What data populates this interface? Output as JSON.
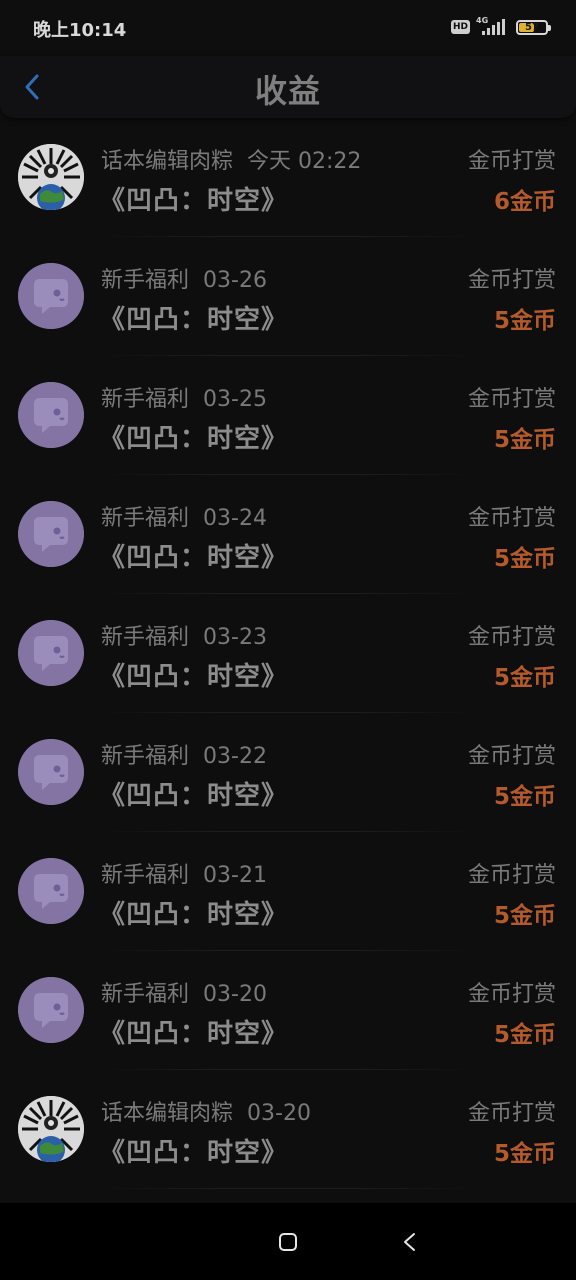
{
  "status_bar": {
    "time": "晚上10:14",
    "hd": "HD",
    "network": "4G",
    "battery": "57",
    "battery_level": 0.57,
    "battery_color": "#e3b32d"
  },
  "header": {
    "title": "收益",
    "back_icon": "chevron-left-icon",
    "accent": "#2f6fb8"
  },
  "items": [
    {
      "sender": "话本编辑肉粽",
      "date": "今天 02:22",
      "title": "《凹凸：时空》",
      "type": "金币打赏",
      "amount": "6金币",
      "avatar": "globe"
    },
    {
      "sender": "新手福利",
      "date": "03-26",
      "title": "《凹凸：时空》",
      "type": "金币打赏",
      "amount": "5金币",
      "avatar": "chat"
    },
    {
      "sender": "新手福利",
      "date": "03-25",
      "title": "《凹凸：时空》",
      "type": "金币打赏",
      "amount": "5金币",
      "avatar": "chat"
    },
    {
      "sender": "新手福利",
      "date": "03-24",
      "title": "《凹凸：时空》",
      "type": "金币打赏",
      "amount": "5金币",
      "avatar": "chat"
    },
    {
      "sender": "新手福利",
      "date": "03-23",
      "title": "《凹凸：时空》",
      "type": "金币打赏",
      "amount": "5金币",
      "avatar": "chat"
    },
    {
      "sender": "新手福利",
      "date": "03-22",
      "title": "《凹凸：时空》",
      "type": "金币打赏",
      "amount": "5金币",
      "avatar": "chat"
    },
    {
      "sender": "新手福利",
      "date": "03-21",
      "title": "《凹凸：时空》",
      "type": "金币打赏",
      "amount": "5金币",
      "avatar": "chat"
    },
    {
      "sender": "新手福利",
      "date": "03-20",
      "title": "《凹凸：时空》",
      "type": "金币打赏",
      "amount": "5金币",
      "avatar": "chat"
    },
    {
      "sender": "话本编辑肉粽",
      "date": "03-20",
      "title": "《凹凸：时空》",
      "type": "金币打赏",
      "amount": "5金币",
      "avatar": "globe"
    }
  ],
  "colors": {
    "amount": "#b55a2a",
    "avatar_chat": "#8374a4"
  },
  "nav_bar": {
    "home_icon": "square-home-icon",
    "back_icon": "triangle-back-icon"
  }
}
